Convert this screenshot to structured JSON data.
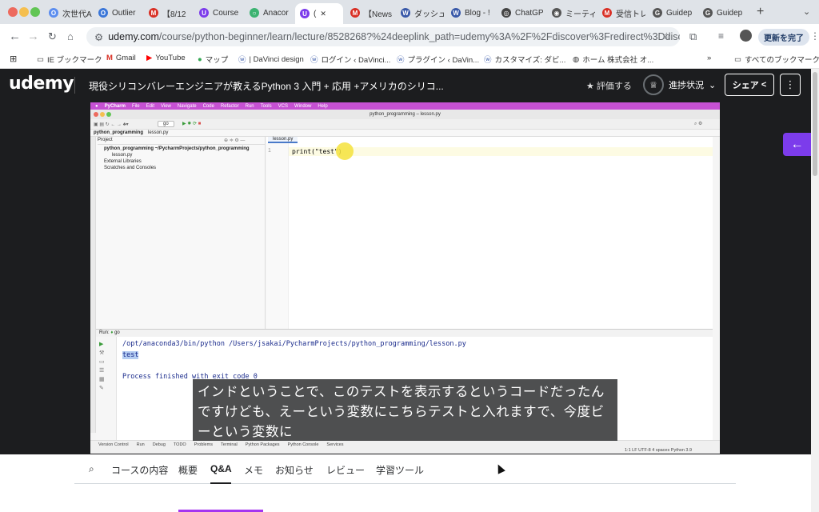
{
  "tabs": [
    {
      "label": "次世代A",
      "color": "#5b8def",
      "glyph": "O"
    },
    {
      "label": "Outlier",
      "color": "#3a76d8",
      "glyph": "O"
    },
    {
      "label": "【8/12",
      "color": "#d93025",
      "glyph": "M"
    },
    {
      "label": "Course",
      "color": "#7c3ceb",
      "glyph": "U"
    },
    {
      "label": "Anacor",
      "color": "#3cb371",
      "glyph": "○"
    },
    {
      "label": "(",
      "color": "#7c3ceb",
      "glyph": "U"
    },
    {
      "label": "【News",
      "color": "#d93025",
      "glyph": "M"
    },
    {
      "label": "ダッシュ",
      "color": "#3858a8",
      "glyph": "W"
    },
    {
      "label": "Blog - !",
      "color": "#3858a8",
      "glyph": "W"
    },
    {
      "label": "ChatGP",
      "color": "#444444",
      "glyph": "◎"
    },
    {
      "label": "ミーティ",
      "color": "#555555",
      "glyph": "◉"
    },
    {
      "label": "受信トレ",
      "color": "#d93025",
      "glyph": "M"
    },
    {
      "label": "Guidep",
      "color": "#555555",
      "glyph": "G"
    },
    {
      "label": "Guidep",
      "color": "#555555",
      "glyph": "G"
    }
  ],
  "url": {
    "host": "udemy.com",
    "path": "/course/python-beginner/learn/lecture/8528268?%24deeplink_path=udemy%3A%2F%2Fdiscover%3Fredirect%3Ddiscussions%26..."
  },
  "update_button": "更新を完了",
  "bookmarks": [
    "IE ブックマーク",
    "Gmail",
    "YouTube",
    "マップ",
    "| DaVinci design",
    "ログイン ‹ DaVinci...",
    "プラグイン ‹ DaVin...",
    "カスタマイズ: ダビ...",
    "ホーム  株式会社 オ...",
    "»",
    "すべてのブックマーク"
  ],
  "udemy": {
    "logo": "udemy",
    "course_title": "現役シリコンバレーエンジニアが教えるPython 3 入門 + 応用 +アメリカのシリコ...",
    "rate": "★ 評価する",
    "progress": "進捗状況",
    "share": "シェア",
    "more": "⋮"
  },
  "pycharm": {
    "menu": [
      "PyCharm",
      "File",
      "Edit",
      "View",
      "Navigate",
      "Code",
      "Refactor",
      "Run",
      "Tools",
      "VCS",
      "Window",
      "Help"
    ],
    "window_title": "python_programming – lesson.py",
    "breadcrumb": [
      "python_programming",
      "lesson.py"
    ],
    "project_label": "Project",
    "tree": [
      "python_programming  ~/PycharmProjects/python_programming",
      "lesson.py",
      "External Libraries",
      "Scratches and Consoles"
    ],
    "editor_tab": "lesson.py",
    "line_no": "1",
    "code": "print(\"test\")",
    "run_label": "Run:",
    "run_config": "go",
    "output_cmd": "/opt/anaconda3/bin/python /Users/jsakai/PycharmProjects/python_programming/lesson.py",
    "output_test": "test",
    "output_finish": "Process finished with exit code 0",
    "status_items": [
      "Version Control",
      "Run",
      "Debug",
      "TODO",
      "Problems",
      "Terminal",
      "Python Packages",
      "Python Console",
      "Services"
    ],
    "status_right": "1:1  LF  UTF-8  4 spaces  Python 3.9"
  },
  "subtitle": "インドということで、このテストを表示するというコードだったんですけども、えーという変数にこちらテストと入れますで、今度ビーという変数に",
  "bottom_nav": [
    "コースの内容",
    "概要",
    "Q&A",
    "メモ",
    "お知らせ",
    "レビュー",
    "学習ツール"
  ],
  "bottom_nav_active": "Q&A"
}
